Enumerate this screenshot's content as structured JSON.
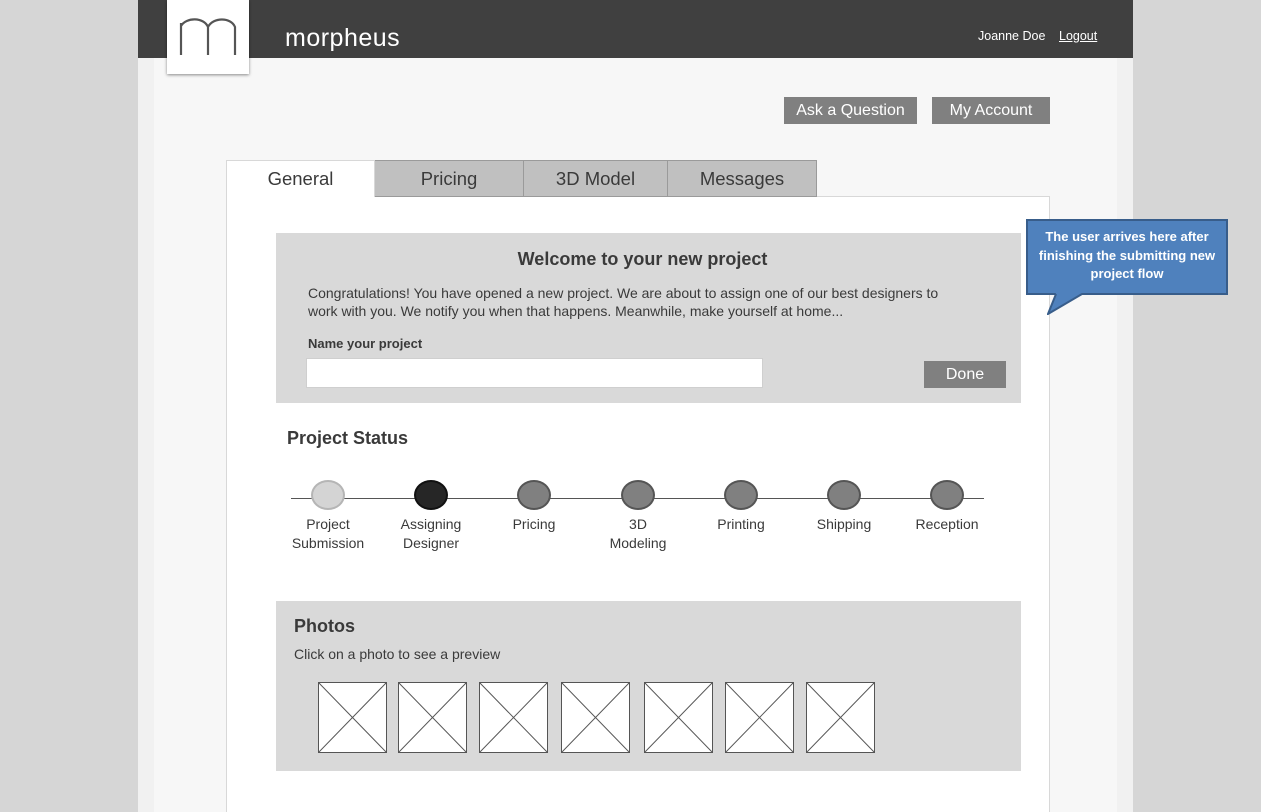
{
  "header": {
    "brand": "morpheus",
    "logo_icon": "morpheus-m-logo-icon",
    "user_name": "Joanne Doe",
    "logout_label": "Logout"
  },
  "actions": {
    "ask_question_label": "Ask a Question",
    "my_account_label": "My Account"
  },
  "tabs": [
    {
      "label": "General",
      "active": true
    },
    {
      "label": "Pricing",
      "active": false
    },
    {
      "label": "3D Model",
      "active": false
    },
    {
      "label": "Messages",
      "active": false
    }
  ],
  "welcome": {
    "title": "Welcome to your new project",
    "body": "Congratulations! You have opened a new project. We are about to assign one of our best designers to work with you. We notify you when  that happens. Meanwhile, make yourself at home...",
    "name_label": "Name your project",
    "name_value": "",
    "done_label": "Done"
  },
  "project_status": {
    "title": "Project Status",
    "steps": [
      {
        "label": "Project Submission",
        "state": "done"
      },
      {
        "label": "Assigning Designer",
        "state": "current"
      },
      {
        "label": "Pricing",
        "state": "pending"
      },
      {
        "label": "3D Modeling",
        "state": "pending"
      },
      {
        "label": "Printing",
        "state": "pending"
      },
      {
        "label": "Shipping",
        "state": "pending"
      },
      {
        "label": "Reception",
        "state": "pending"
      }
    ]
  },
  "photos": {
    "title": "Photos",
    "hint": "Click on a photo to see a preview",
    "thumbnail_icon": "image-placeholder-icon",
    "count": 7
  },
  "callout": {
    "text": "The user arrives here after finishing the submitting new project flow"
  },
  "colors": {
    "header_bg": "#404040",
    "button_gray": "#808080",
    "callout_blue": "#4f81bd",
    "current_step": "#262626"
  }
}
